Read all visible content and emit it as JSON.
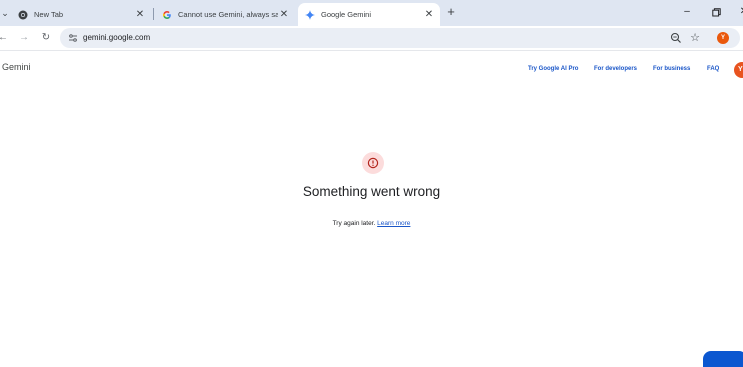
{
  "browser": {
    "tabs": [
      {
        "title": "New Tab",
        "favicon": "chrome-icon"
      },
      {
        "title": "Cannot use Gemini, always says",
        "favicon": "google-g-icon"
      },
      {
        "title": "Google Gemini",
        "favicon": "gemini-sparkle-icon",
        "active": true
      }
    ],
    "new_tab_symbol": "+",
    "url": "gemini.google.com",
    "profile_initial": "Y"
  },
  "page": {
    "brand": "Gemini",
    "nav": [
      "Try Google AI Pro",
      "For developers",
      "For business",
      "FAQ"
    ],
    "avatar_initial": "Y",
    "error": {
      "title": "Something went wrong",
      "message": "Try again later.",
      "link": "Learn more"
    }
  },
  "colors": {
    "accent": "#1a56c8",
    "error_bg": "#fcdcdc",
    "error_icon": "#b3261e",
    "avatar": "#e8531f"
  }
}
